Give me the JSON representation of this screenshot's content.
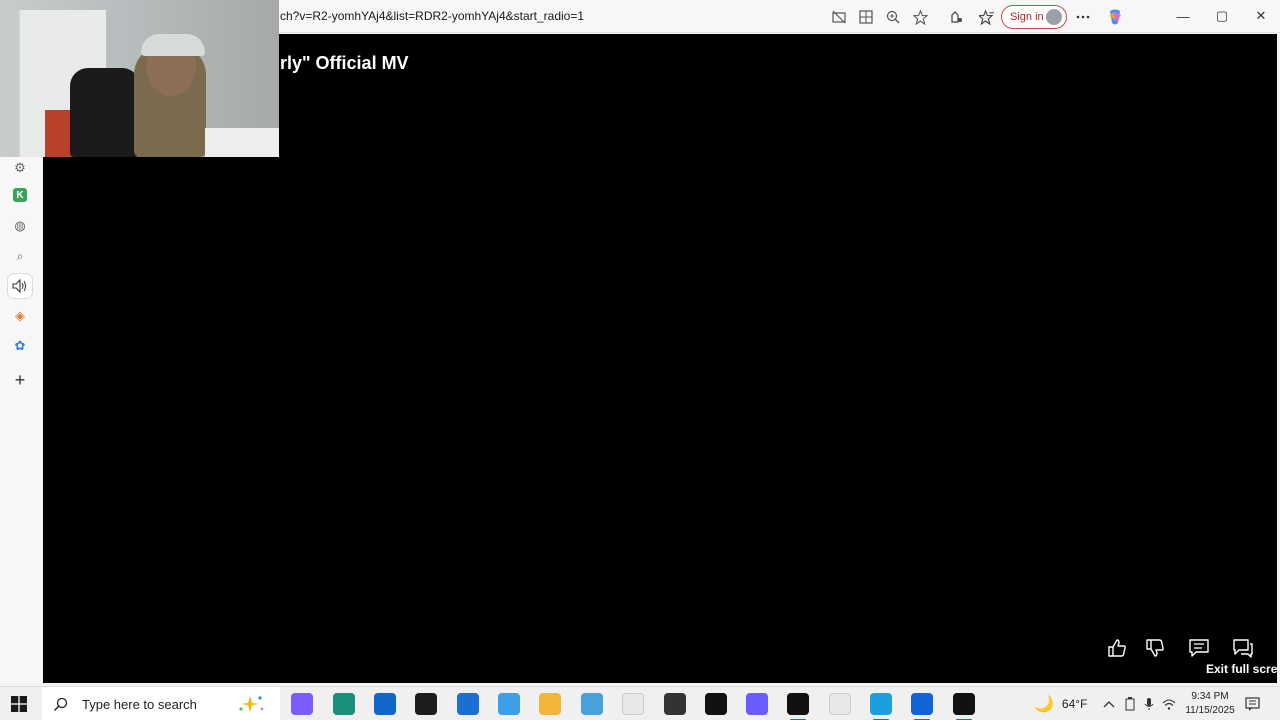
{
  "browser": {
    "url": "ch?v=R2-yomhYAj4&list=RDR2-yomhYAj4&start_radio=1",
    "sign_in_label": "Sign in",
    "icons": [
      "camera-off-icon",
      "app-install-icon",
      "zoom-icon",
      "favorite-star-icon",
      "extensions-icon",
      "favorites-icon",
      "more-icon",
      "copilot-icon"
    ]
  },
  "window_controls": {
    "minimize": "—",
    "maximize": "▢",
    "close": "✕"
  },
  "sidebar": {
    "items": [
      {
        "name": "settings-gear-icon",
        "glyph": "⚙"
      },
      {
        "name": "app-k-icon",
        "glyph": "K"
      },
      {
        "name": "globe-icon",
        "glyph": "◍"
      },
      {
        "name": "search-icon",
        "glyph": "⌕"
      },
      {
        "name": "speaker-icon",
        "glyph": "🔊"
      },
      {
        "name": "drop-icon",
        "glyph": "◈"
      },
      {
        "name": "butterfly-icon",
        "glyph": "✿"
      },
      {
        "name": "add-icon",
        "glyph": "+"
      }
    ]
  },
  "video": {
    "title_fragment": "rly\" Official MV",
    "exit_fullscreen_label": "Exit full scree"
  },
  "taskbar": {
    "search_placeholder": "Type here to search",
    "weather": "64°F",
    "time": "9:34 PM",
    "date": "11/15/2025",
    "apps": [
      {
        "name": "copilot-app",
        "color": "#7b5cff",
        "on": false
      },
      {
        "name": "edge-dev-app",
        "color": "#1a8f7a",
        "on": false
      },
      {
        "name": "store-app",
        "color": "#1167c8",
        "on": false
      },
      {
        "name": "terminal-app",
        "color": "#1d1d1d",
        "on": false
      },
      {
        "name": "health-app",
        "color": "#1a6fd1",
        "on": false
      },
      {
        "name": "feedback-app",
        "color": "#3aa0e8",
        "on": false
      },
      {
        "name": "file-explorer-app",
        "color": "#f2b53a",
        "on": false
      },
      {
        "name": "notepad-blue-app",
        "color": "#4aa0d8",
        "on": false
      },
      {
        "name": "blank-doc-app",
        "color": "#e8e8e8",
        "on": false
      },
      {
        "name": "circle-app",
        "color": "#333333",
        "on": false
      },
      {
        "name": "tiktok-app",
        "color": "#111111",
        "on": false
      },
      {
        "name": "messenger-app",
        "color": "#6a5cff",
        "on": false
      },
      {
        "name": "capcut-app",
        "color": "#111111",
        "on": true
      },
      {
        "name": "blank-doc-app-2",
        "color": "#e8e8e8",
        "on": false
      },
      {
        "name": "edge-app",
        "color": "#1b9fe0",
        "on": true
      },
      {
        "name": "roblox-studio-app",
        "color": "#1264d6",
        "on": true
      },
      {
        "name": "recorder-app",
        "color": "#111111",
        "on": true
      }
    ]
  }
}
